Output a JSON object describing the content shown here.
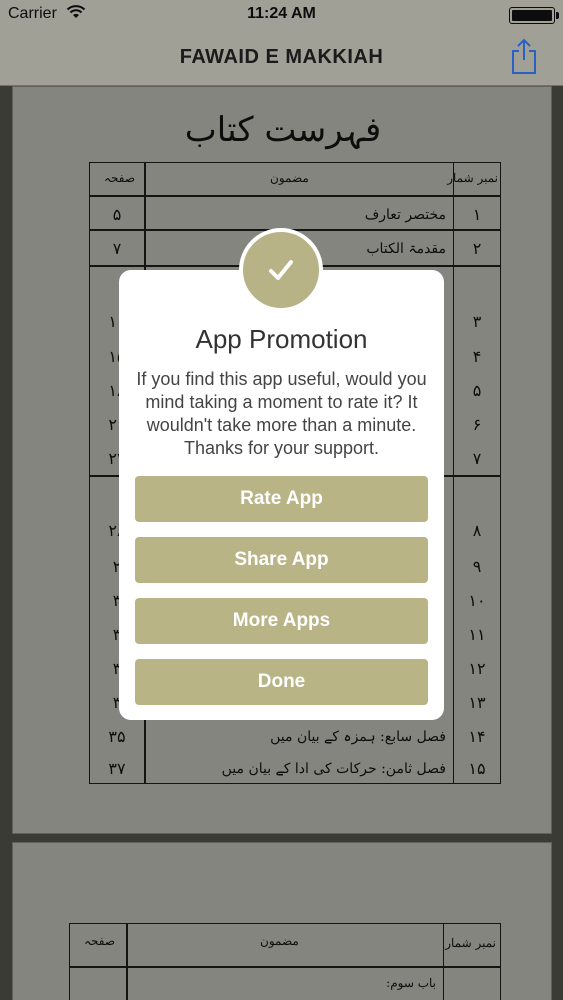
{
  "status_bar": {
    "carrier": "Carrier",
    "time": "11:24 AM"
  },
  "nav": {
    "title": "FAWAID E MAKKIAH",
    "share_icon": "share-icon"
  },
  "document": {
    "heading": "فہرست کتاب",
    "columns": {
      "number": "نمبر شمار",
      "subject": "مضمون",
      "page": "صفحہ"
    },
    "rows": [
      {
        "num": "۱",
        "title": "مختصر تعارف",
        "page": "۵"
      },
      {
        "num": "۲",
        "title": "مقدمۃ الکتاب",
        "page": "۷"
      },
      {
        "num": "۳",
        "title": "",
        "page": "۱۰"
      },
      {
        "num": "۴",
        "title": "",
        "page": "۱۵"
      },
      {
        "num": "۵",
        "title": "",
        "page": "۱۸"
      },
      {
        "num": "۶",
        "title": "",
        "page": "۲۱"
      },
      {
        "num": "۷",
        "title": "",
        "page": "۲۴"
      },
      {
        "num": "۸",
        "title": "",
        "page": "۲۸"
      },
      {
        "num": "۹",
        "title": "",
        "page": "۲"
      },
      {
        "num": "۱۰",
        "title": "",
        "page": "۳"
      },
      {
        "num": "۱۱",
        "title": "",
        "page": "۳"
      },
      {
        "num": "۱۲",
        "title": "",
        "page": "۳"
      },
      {
        "num": "۱۳",
        "title": "",
        "page": "۳"
      },
      {
        "num": "۱۴",
        "title": "فصل سابع:    ہمزہ کے بیان میں",
        "page": "۳۵"
      },
      {
        "num": "۱۵",
        "title": "فصل ثامن:    حرکات کی ادا کے بیان میں",
        "page": "۳۷"
      }
    ],
    "page2": {
      "columns": {
        "number": "نمبر شمار",
        "subject": "مضمون",
        "page": "صفحہ"
      },
      "row_label": "باب سوم:"
    }
  },
  "modal": {
    "badge_icon": "checkmark-icon",
    "title": "App Promotion",
    "message": "If you find this app useful, would you mind taking a moment to rate it? It wouldn't take more than a minute. Thanks for your support.",
    "buttons": {
      "rate": "Rate App",
      "share": "Share App",
      "more": "More Apps",
      "done": "Done"
    },
    "accent_color": "#b9b486"
  }
}
